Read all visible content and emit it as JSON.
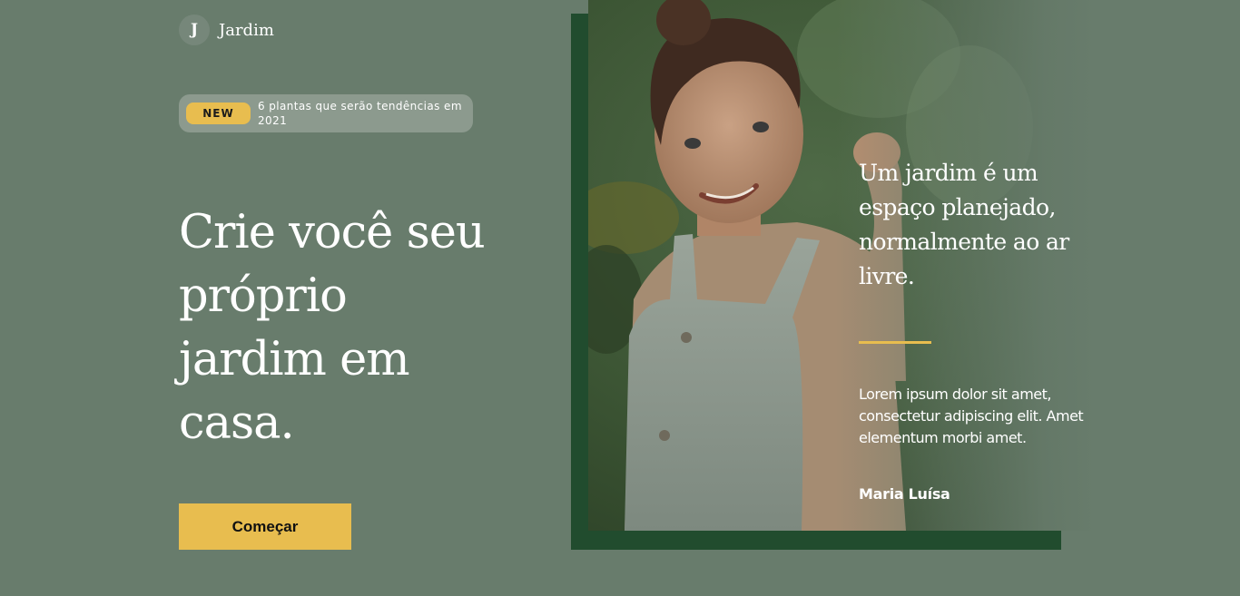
{
  "brand": {
    "logo_letter": "J",
    "name": "Jardim"
  },
  "announcement": {
    "badge": "NEW",
    "text": "6 plantas que serão tendências em 2021"
  },
  "hero": {
    "headline": "Crie você seu próprio jardim em casa.",
    "cta_label": "Começar"
  },
  "testimonial": {
    "quote": "Um jardim é um espaço planejado, normalmente ao ar livre.",
    "body": "Lorem ipsum dolor sit amet, consectetur adipiscing elit. Amet elementum morbi amet.",
    "author": "Maria Luísa"
  },
  "colors": {
    "background": "#687c6c",
    "accent": "#e8bd4f",
    "frame": "#214c2e"
  }
}
